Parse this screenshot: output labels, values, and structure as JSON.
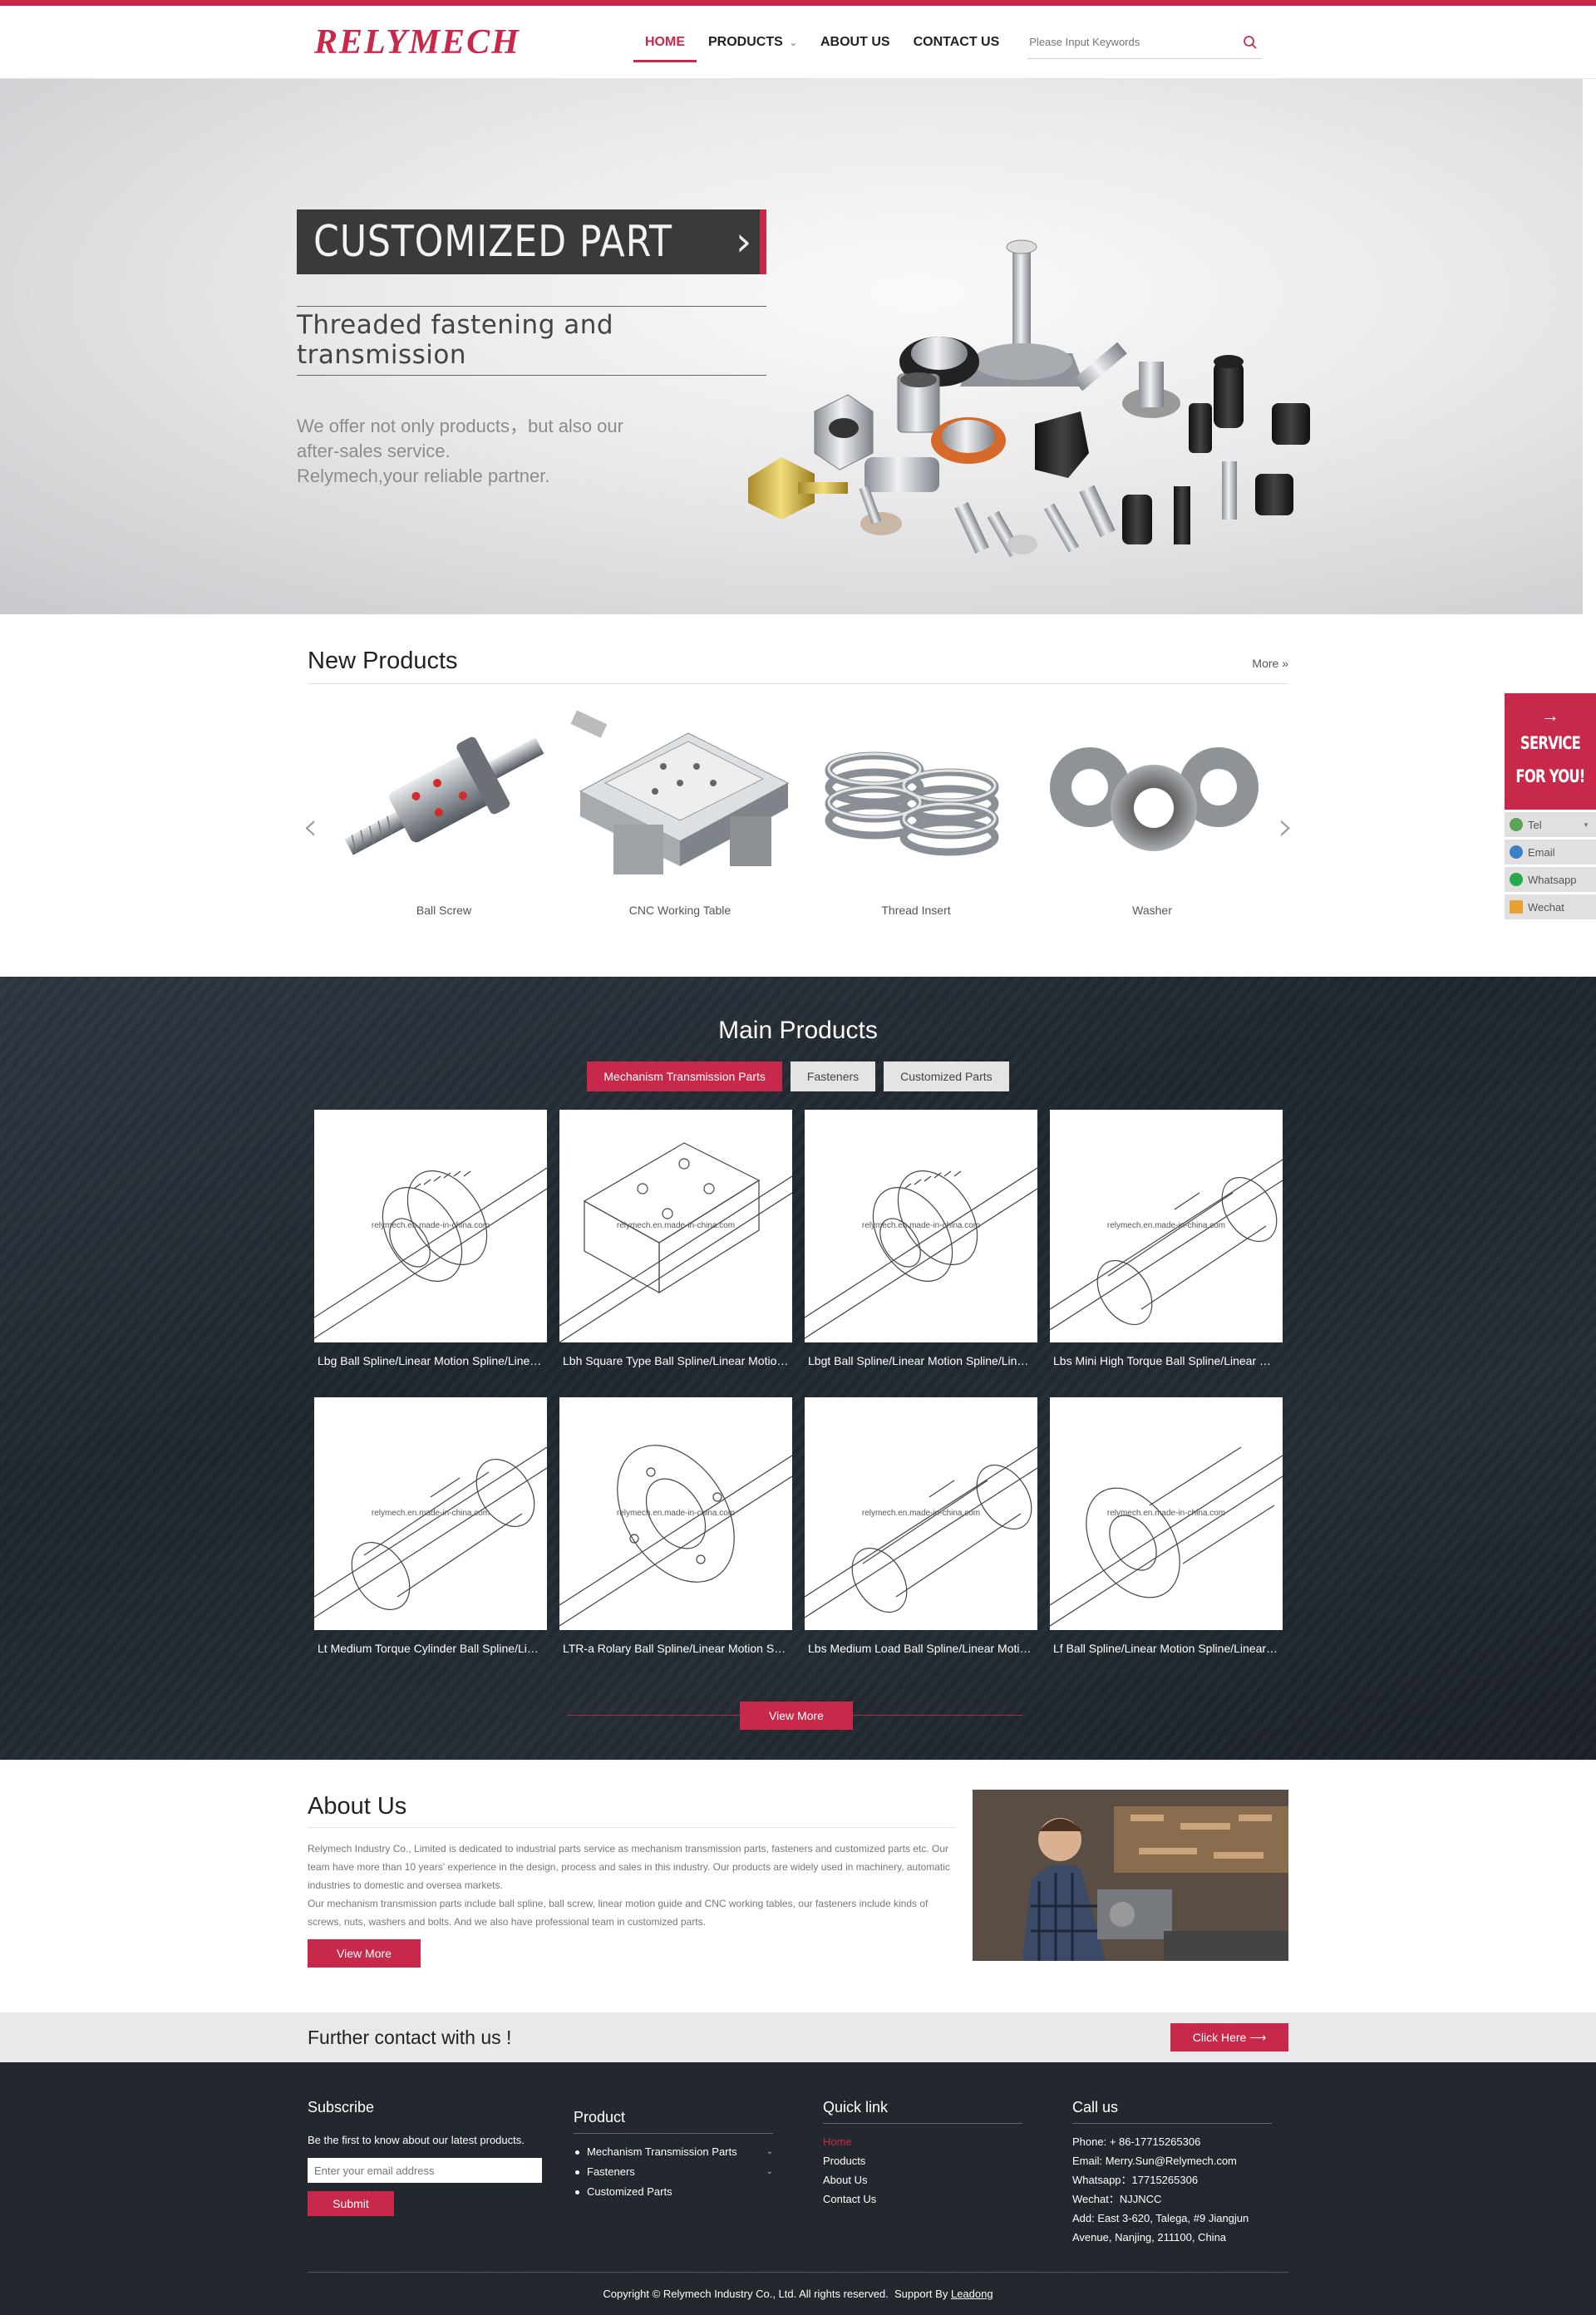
{
  "header": {
    "logo": "RELYMECH",
    "nav": [
      {
        "label": "HOME",
        "active": true
      },
      {
        "label": "PRODUCTS",
        "has_dropdown": true
      },
      {
        "label": "ABOUT US"
      },
      {
        "label": "CONTACT US"
      }
    ],
    "search_placeholder": "Please Input Keywords",
    "accent_color": "#c8284a"
  },
  "banner": {
    "title": "CUSTOMIZED PART",
    "subtitle": "Threaded fastening and transmission",
    "desc_lines": [
      "We offer not only products，but also our",
      "after-sales service.",
      "Relymech,your reliable partner."
    ],
    "slides": 3,
    "active_slide": 3
  },
  "new_products": {
    "title": "New Products",
    "more": "More »",
    "items": [
      {
        "label": "Ball Screw",
        "icon": "ball-screw"
      },
      {
        "label": "CNC Working Table",
        "icon": "cnc-table"
      },
      {
        "label": "Thread Insert",
        "icon": "thread-insert"
      },
      {
        "label": "Washer",
        "icon": "washer"
      }
    ]
  },
  "main_products": {
    "title": "Main Products",
    "tabs": [
      {
        "label": "Mechanism Transmission Parts",
        "active": true
      },
      {
        "label": "Fasteners"
      },
      {
        "label": "Customized Parts"
      }
    ],
    "watermark": "relymech.en.made-in-china.com",
    "products": [
      {
        "title": "Lbg Ball Spline/Linear Motion Spline/Linear Motion Guide",
        "icon": "ball-spline-gear"
      },
      {
        "title": "Lbh Square Type Ball Spline/Linear Motion Spline",
        "icon": "square-block"
      },
      {
        "title": "Lbgt Ball Spline/Linear Motion Spline/Linear Guide",
        "icon": "ball-spline-gear"
      },
      {
        "title": "Lbs Mini High Torque Ball Spline/Linear Motion Spline",
        "icon": "cylinder-spline"
      },
      {
        "title": "Lt Medium Torque Cylinder Ball Spline/Linear Motion",
        "icon": "cylinder-spline"
      },
      {
        "title": "LTR-a Rolary Ball Spline/Linear Motion Spline",
        "icon": "flange-spline"
      },
      {
        "title": "Lbs Medium Load Ball Spline/Linear Motion Spline",
        "icon": "cylinder-spline"
      },
      {
        "title": "Lf Ball Spline/Linear Motion Spline/Linear Guide",
        "icon": "flange-spline"
      }
    ],
    "view_more": "View More"
  },
  "about": {
    "title": "About Us",
    "paragraph1": "Relymech Industry Co., Limited is dedicated to industrial parts service as mechanism transmission parts, fasteners and customized parts etc. Our team have more than 10 years' experience in the design, process and sales in this industry. Our products are widely used in machinery, automatic industries to domestic and oversea markets.",
    "paragraph2": "Our mechanism transmission parts include ball spline, ball screw, linear motion guide and CNC working tables, our fasteners include kinds of screws, nuts, washers and bolts. And we also have professional team in customized parts.",
    "view_more": "View More"
  },
  "further": {
    "title": "Further contact with us !",
    "button": "Click Here ⟶"
  },
  "footer": {
    "subscribe": {
      "title": "Subscribe",
      "text": "Be the first to know about our latest products.",
      "placeholder": "Enter your email address",
      "button": "Submit"
    },
    "product": {
      "title": "Product",
      "items": [
        {
          "label": "Mechanism Transmission Parts",
          "has_dropdown": true
        },
        {
          "label": "Fasteners",
          "has_dropdown": true
        },
        {
          "label": "Customized Parts",
          "has_dropdown": false
        }
      ]
    },
    "quick": {
      "title": "Quick link",
      "items": [
        {
          "label": "Home",
          "active": true
        },
        {
          "label": "Products"
        },
        {
          "label": "About Us"
        },
        {
          "label": "Contact Us"
        }
      ]
    },
    "call": {
      "title": "Call us",
      "lines": [
        "Phone: + 86-17715265306",
        "Email: Merry.Sun@Relymech.com",
        "Whatsapp：17715265306",
        "Wechat：NJJNCC",
        "Add: East 3-620, Talega, #9 Jiangjun",
        "Avenue, Nanjing, 211100, China"
      ]
    },
    "copyright": "Copyright © Relymech Industry Co., Ltd. All rights reserved.",
    "support_prefix": "Support By",
    "support_link": "Leadong"
  },
  "service_widget": {
    "line1": "SERVICE",
    "line2": "FOR YOU!",
    "items": [
      {
        "label": "Tel",
        "color": "#5aa55a",
        "has_caret": true
      },
      {
        "label": "Email",
        "color": "#3c7fc2"
      },
      {
        "label": "Whatsapp",
        "color": "#25a84a"
      },
      {
        "label": "Wechat",
        "color": "#e8a030"
      }
    ]
  }
}
